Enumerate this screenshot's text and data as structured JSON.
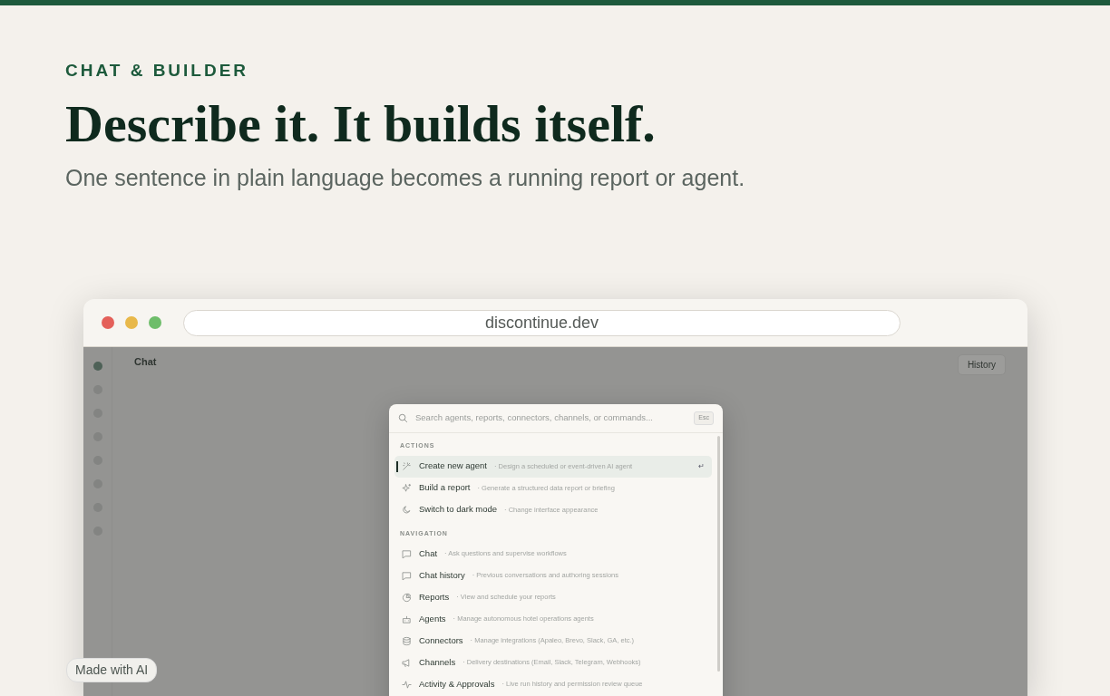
{
  "eyebrow": "CHAT & BUILDER",
  "headline": "Describe it. It builds itself.",
  "subtitle": "One sentence in plain language becomes a running report or agent.",
  "browser": {
    "url": "discontinue.dev",
    "app": {
      "page_title": "Chat",
      "history_button": "History"
    },
    "palette": {
      "placeholder": "Search agents, reports, connectors, channels, or commands...",
      "esc_key": "Esc",
      "sections": [
        {
          "label": "ACTIONS",
          "items": [
            {
              "label": "Create new agent",
              "description": "· Design a scheduled or event-driven AI agent",
              "selected": true,
              "shortcut": "↵"
            },
            {
              "label": "Build a report",
              "description": "· Generate a structured data report or briefing",
              "selected": false
            },
            {
              "label": "Switch to dark mode",
              "description": "· Change interface appearance",
              "selected": false
            }
          ]
        },
        {
          "label": "NAVIGATION",
          "items": [
            {
              "label": "Chat",
              "description": "· Ask questions and supervise workflows",
              "selected": false
            },
            {
              "label": "Chat history",
              "description": "· Previous conversations and authoring sessions",
              "selected": false
            },
            {
              "label": "Reports",
              "description": "· View and schedule your reports",
              "selected": false
            },
            {
              "label": "Agents",
              "description": "· Manage autonomous hotel operations agents",
              "selected": false
            },
            {
              "label": "Connectors",
              "description": "· Manage integrations (Apaleo, Brevo, Slack, GA, etc.)",
              "selected": false
            },
            {
              "label": "Channels",
              "description": "· Delivery destinations (Email, Slack, Telegram, Webhooks)",
              "selected": false
            },
            {
              "label": "Activity & Approvals",
              "description": "· Live run history and permission review queue",
              "selected": false
            }
          ]
        }
      ]
    }
  },
  "badge": "Made with AI"
}
